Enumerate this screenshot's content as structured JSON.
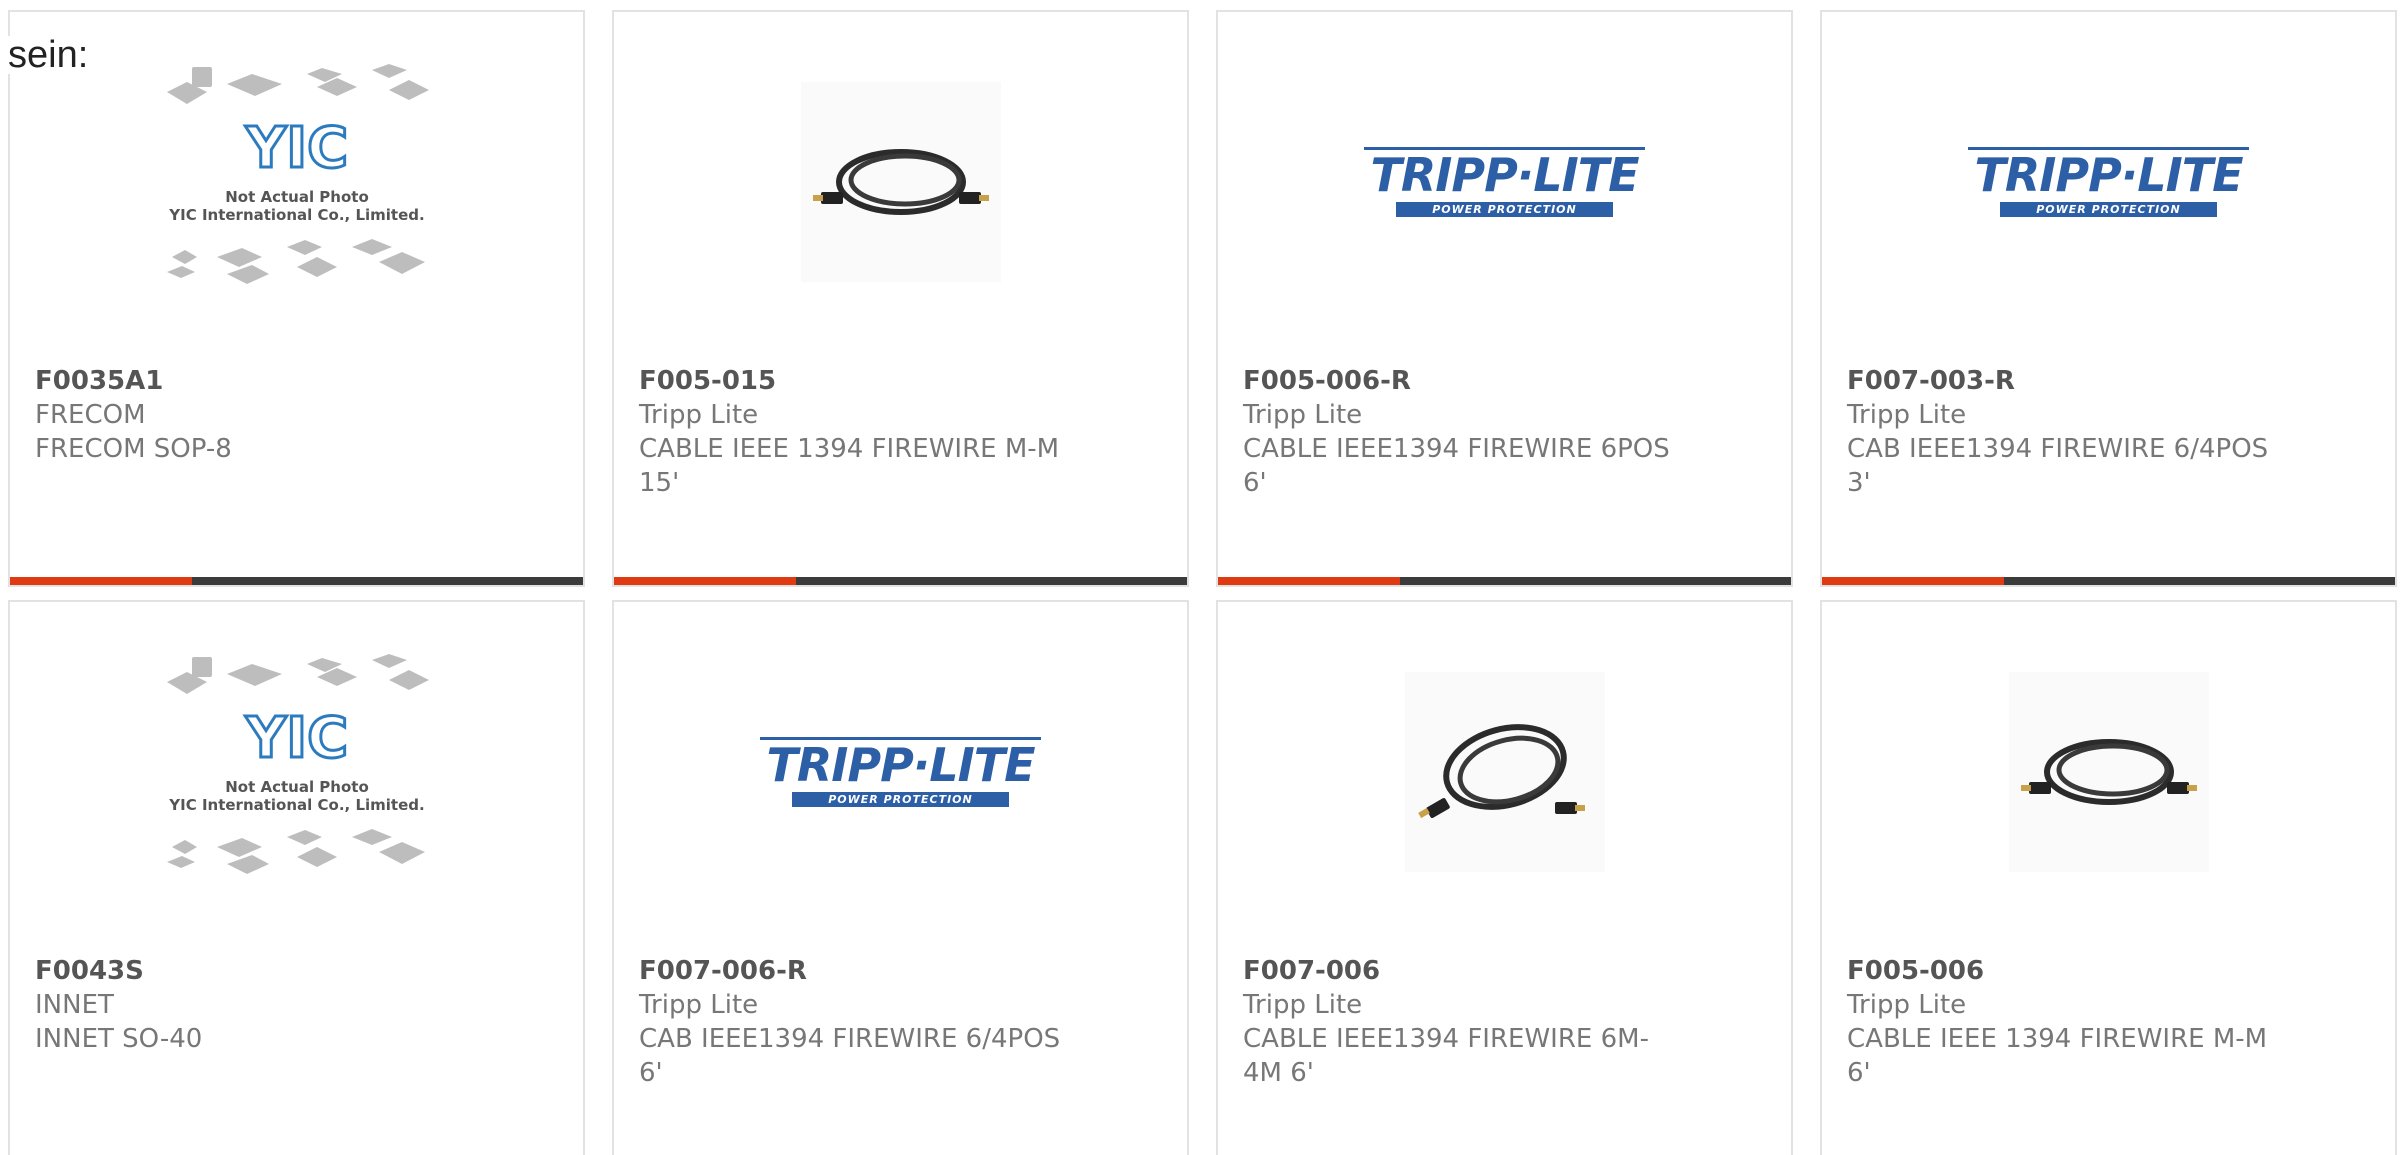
{
  "page": {
    "intro_text": "sein:"
  },
  "image_texts": {
    "yic_logo": "YIC",
    "yic_note1": "Not Actual Photo",
    "yic_note2": "YIC International Co., Limited.",
    "tripp_logo": "TRIPP·LITE",
    "tripp_sub": "POWER PROTECTION"
  },
  "products": [
    {
      "sku": "F0035A1",
      "manufacturer": "FRECOM",
      "description": "FRECOM SOP-8",
      "image": "yic-placeholder"
    },
    {
      "sku": "F005-015",
      "manufacturer": "Tripp Lite",
      "description": "CABLE IEEE 1394 FIREWIRE M-M 15'",
      "image": "firewire-cable"
    },
    {
      "sku": "F005-006-R",
      "manufacturer": "Tripp Lite",
      "description": "CABLE IEEE1394 FIREWIRE 6POS 6'",
      "image": "tripp-lite-logo"
    },
    {
      "sku": "F007-003-R",
      "manufacturer": "Tripp Lite",
      "description": "CAB IEEE1394 FIREWIRE 6/4POS 3'",
      "image": "tripp-lite-logo"
    },
    {
      "sku": "F0043S",
      "manufacturer": "INNET",
      "description": "INNET SO-40",
      "image": "yic-placeholder"
    },
    {
      "sku": "F007-006-R",
      "manufacturer": "Tripp Lite",
      "description": "CAB IEEE1394 FIREWIRE 6/4POS 6'",
      "image": "tripp-lite-logo"
    },
    {
      "sku": "F007-006",
      "manufacturer": "Tripp Lite",
      "description": "CABLE IEEE1394 FIREWIRE 6M-4M 6'",
      "image": "firewire-cable"
    },
    {
      "sku": "F005-006",
      "manufacturer": "Tripp Lite",
      "description": "CABLE IEEE 1394 FIREWIRE M-M 6'",
      "image": "firewire-cable"
    }
  ],
  "colors": {
    "accent": "#e03a12",
    "bar": "#3b3b3b",
    "brand_blue": "#2d5fa6"
  }
}
